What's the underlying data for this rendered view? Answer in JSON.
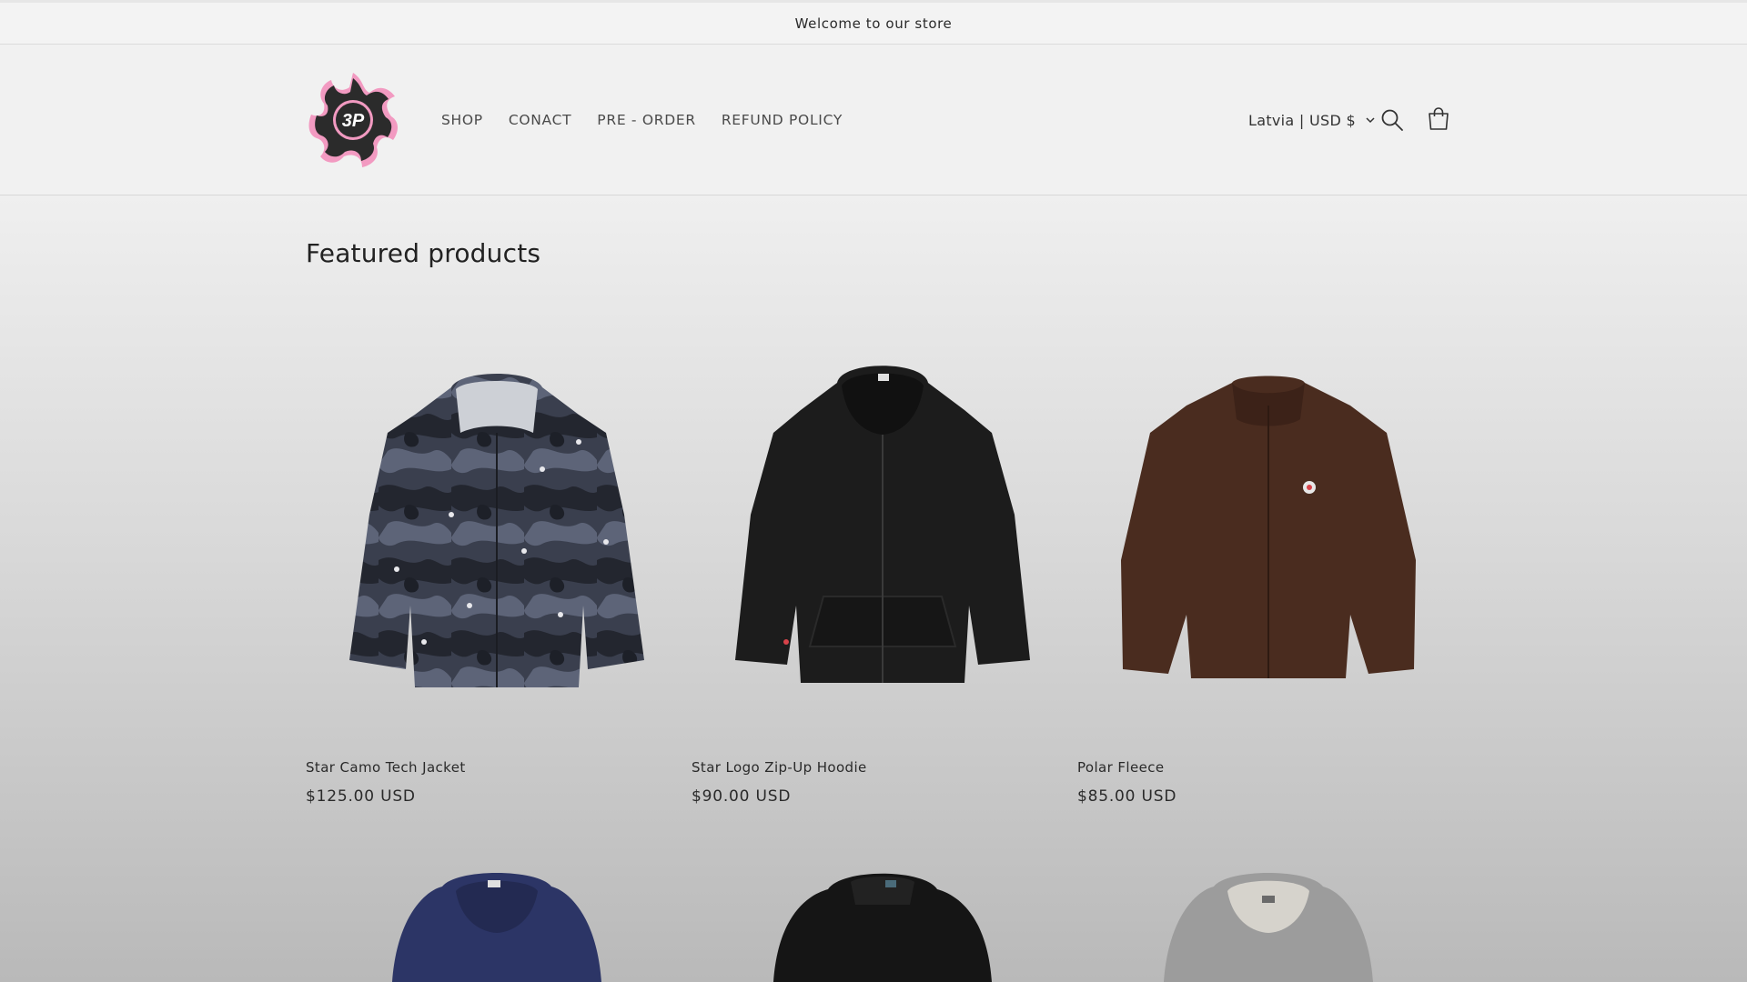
{
  "announcement": {
    "text": "Welcome to our store"
  },
  "header": {
    "logo_text": "3P",
    "nav": [
      {
        "label": "SHOP"
      },
      {
        "label": "CONACT"
      },
      {
        "label": "PRE - ORDER"
      },
      {
        "label": "REFUND POLICY"
      }
    ],
    "locale": "Latvia | USD $",
    "icons": [
      "search-icon",
      "cart-icon",
      "chevron-down-icon"
    ]
  },
  "featured": {
    "title": "Featured products",
    "products": [
      {
        "title": "Star Camo Tech Jacket",
        "price": "$125.00 USD"
      },
      {
        "title": "Star Logo Zip-Up Hoodie",
        "price": "$90.00 USD"
      },
      {
        "title": "Polar Fleece",
        "price": "$85.00 USD"
      }
    ]
  },
  "colors": {
    "accent_pink": "#f29ac1",
    "logo_dark": "#2b2b2b",
    "text": "#2a2a2a"
  }
}
